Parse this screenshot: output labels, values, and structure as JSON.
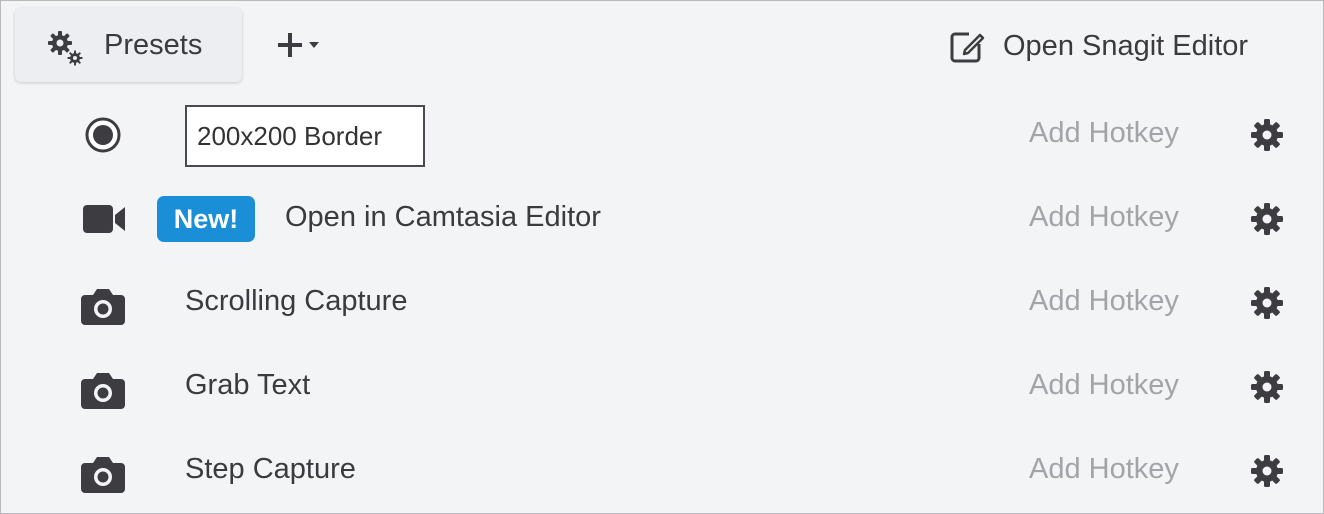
{
  "toolbar": {
    "presets_label": "Presets",
    "presets_icon": "gears-icon",
    "add_icon": "plus-dropdown-icon",
    "open_editor_label": "Open Snagit Editor",
    "open_editor_icon": "edit-icon"
  },
  "presets": [
    {
      "type_icon": "radio-selected-icon",
      "name": "200x200 Border",
      "editing": true,
      "hotkey_label": "Add Hotkey"
    },
    {
      "type_icon": "video-camera-icon",
      "badge": "New!",
      "name": "Open in Camtasia Editor",
      "hotkey_label": "Add Hotkey"
    },
    {
      "type_icon": "camera-icon",
      "name": "Scrolling Capture",
      "hotkey_label": "Add Hotkey"
    },
    {
      "type_icon": "camera-icon",
      "name": "Grab Text",
      "hotkey_label": "Add Hotkey"
    },
    {
      "type_icon": "camera-icon",
      "name": "Step Capture",
      "hotkey_label": "Add Hotkey"
    }
  ],
  "colors": {
    "background": "#f3f4f6",
    "text": "#3b3b3f",
    "hotkey_text": "#a3a4a8",
    "badge": "#1a8fd8",
    "icon": "#3d3d41"
  }
}
